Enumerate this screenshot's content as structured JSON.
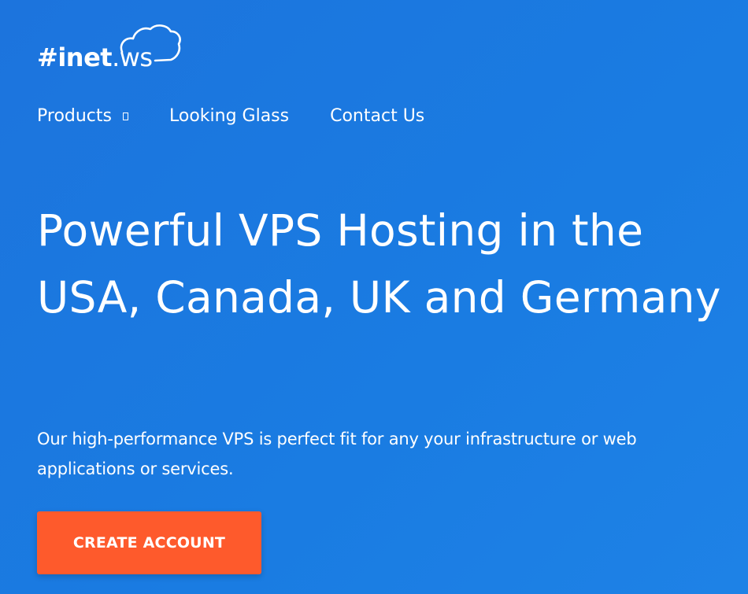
{
  "logo": {
    "hash_text": "#inet",
    "suffix_text": ".ws",
    "icon": "cloud-icon"
  },
  "nav": {
    "items": [
      {
        "label": "Products",
        "has_dropdown": true,
        "dropdown_icon": "caret-icon"
      },
      {
        "label": "Looking Glass"
      },
      {
        "label": "Contact Us"
      }
    ]
  },
  "hero": {
    "title": "Powerful VPS Hosting in the USA, Canada, UK and Germany",
    "subtitle": "Our high-performance VPS is perfect fit for any your infrastructure or web applications or services.",
    "cta_label": "CREATE ACCOUNT"
  },
  "colors": {
    "background": "#1979e0",
    "cta": "#fe5a2c",
    "text": "#ffffff"
  }
}
